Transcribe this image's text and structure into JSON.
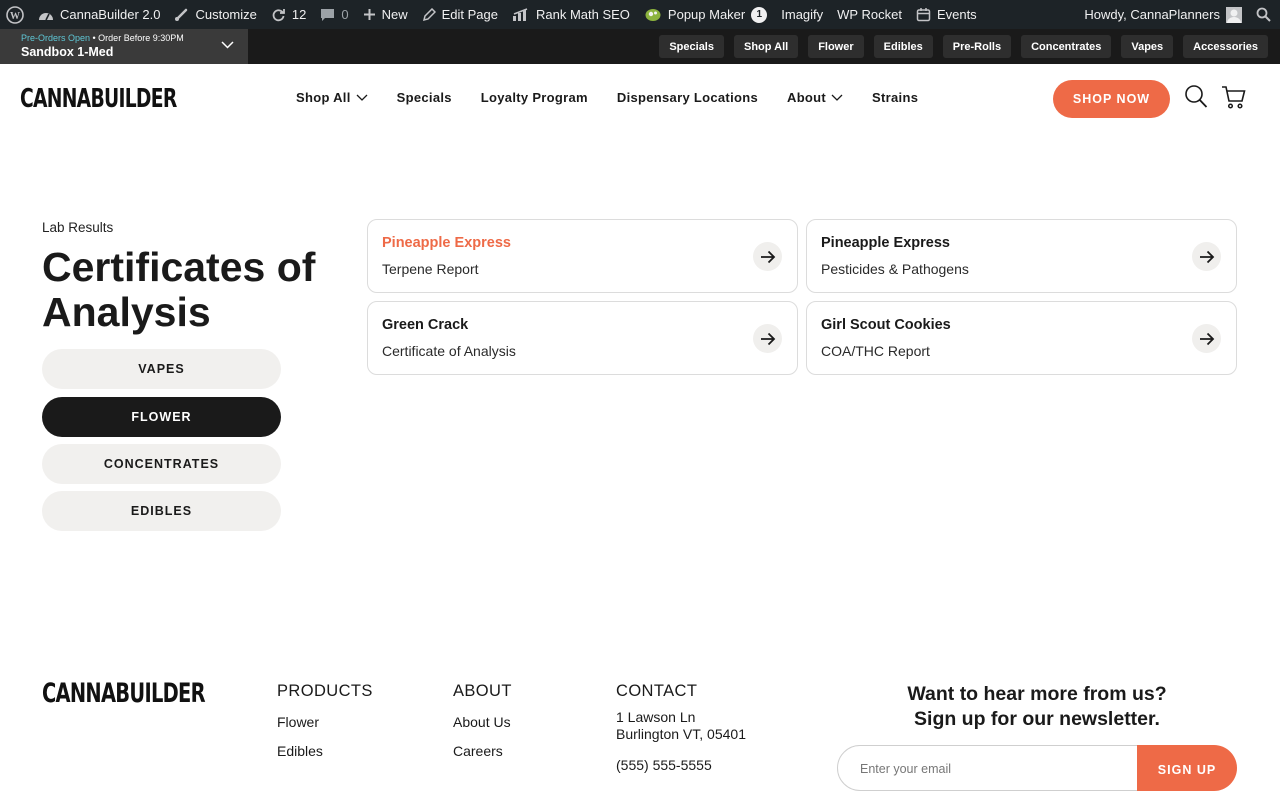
{
  "admin_bar": {
    "site_name": "CannaBuilder 2.0",
    "customize": "Customize",
    "updates_count": "12",
    "comments_count": "0",
    "new": "New",
    "edit_page": "Edit Page",
    "rank_math": "Rank Math SEO",
    "popup_maker": "Popup Maker",
    "popup_badge": "1",
    "imagify": "Imagify",
    "wp_rocket": "WP Rocket",
    "events": "Events",
    "greeting": "Howdy, CannaPlanners"
  },
  "store_bar": {
    "status_open": "Pre-Orders Open",
    "status_rest": " • Order Before 9:30PM",
    "store_name": "Sandbox 1-Med",
    "chips": [
      "Specials",
      "Shop All",
      "Flower",
      "Edibles",
      "Pre-Rolls",
      "Concentrates",
      "Vapes",
      "Accessories"
    ]
  },
  "header": {
    "logo": "CANNABUILDER",
    "nav": [
      "Shop All",
      "Specials",
      "Loyalty Program",
      "Dispensary Locations",
      "About",
      "Strains"
    ],
    "shop_now": "SHOP NOW"
  },
  "main": {
    "eyebrow": "Lab Results",
    "title": "Certificates of Analysis",
    "filters": [
      "VAPES",
      "FLOWER",
      "CONCENTRATES",
      "EDIBLES"
    ],
    "active_filter": "FLOWER",
    "cards": [
      {
        "title": "Pineapple Express",
        "subtitle": "Terpene Report"
      },
      {
        "title": "Pineapple Express",
        "subtitle": "Pesticides & Pathogens"
      },
      {
        "title": "Green Crack",
        "subtitle": "Certificate of Analysis"
      },
      {
        "title": "Girl Scout Cookies",
        "subtitle": "COA/THC Report"
      }
    ]
  },
  "footer": {
    "logo": "CANNABUILDER",
    "products_heading": "PRODUCTS",
    "products_links": [
      "Flower",
      "Edibles"
    ],
    "about_heading": "ABOUT",
    "about_links": [
      "About Us",
      "Careers"
    ],
    "contact_heading": "CONTACT",
    "address_line1": "1 Lawson Ln",
    "address_line2": "Burlington VT, 05401",
    "phone": "(555) 555-5555",
    "newsletter_line1": "Want to hear more from us?",
    "newsletter_line2": "Sign up for our newsletter.",
    "email_placeholder": "Enter your email",
    "signup": "SIGN UP"
  },
  "colors": {
    "accent": "#ee6a47",
    "admin_bar": "#1d2327",
    "store_bar": "#1a1a1a",
    "status_open": "#5fc7d6"
  }
}
